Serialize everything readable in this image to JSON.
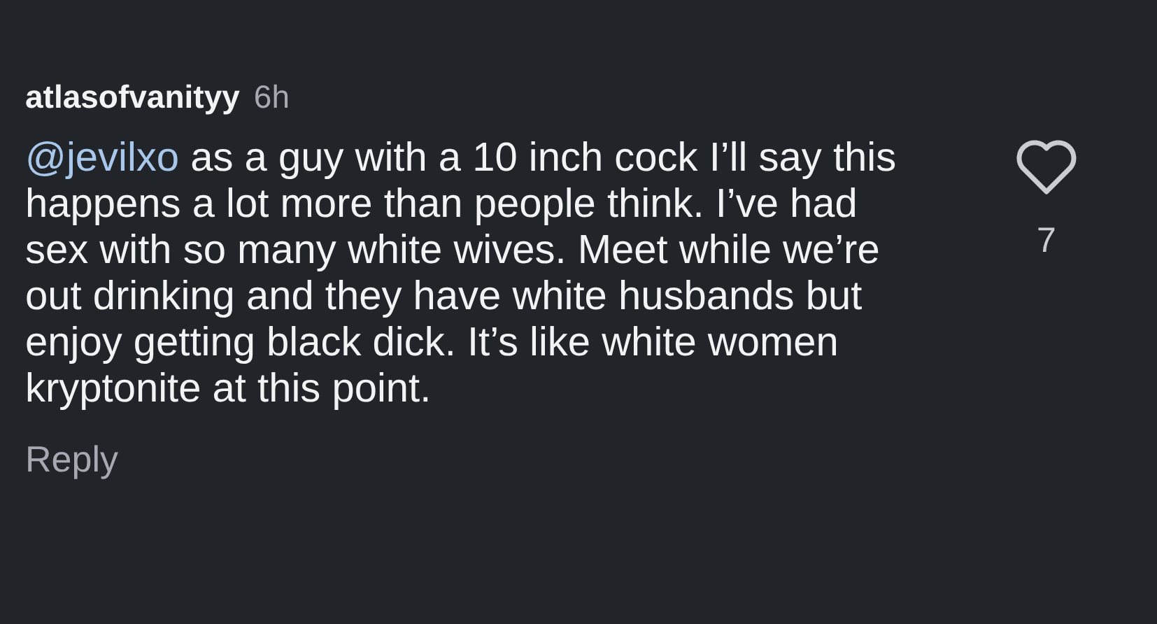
{
  "comment": {
    "username": "atlasofvanityy",
    "time": "6h",
    "mention": "@jevilxo",
    "text": " as a guy with a 10 inch cock I’ll say this happens a lot more than people think. I’ve had sex with so many white wives. Meet while we’re out drinking and they have white husbands but enjoy getting black dick. It’s like white women kryptonite at this point.",
    "liked": false,
    "likes": "7",
    "reply": "Reply"
  }
}
